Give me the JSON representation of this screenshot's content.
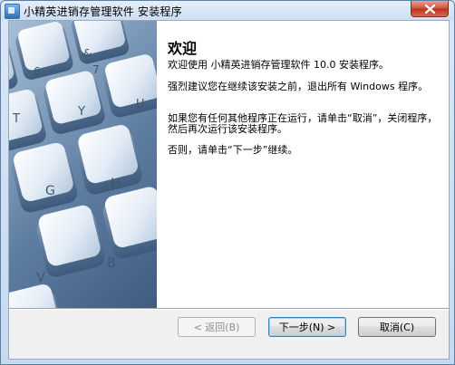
{
  "window": {
    "title": "小精英进销存管理软件 安装程序"
  },
  "colors": {
    "title_bar": "#dbe8f6",
    "close_button": "#c9523e",
    "content_bg": "#ffffff",
    "button_bg": "#e5e5e5",
    "focus_border": "#3c7fb1"
  },
  "icons": {
    "app": "installer-app-icon",
    "close": "close-icon",
    "side": "keyboard-keys-image"
  },
  "side_image": {
    "key_labels": [
      "6",
      "&",
      "7",
      "T",
      "Y",
      "U",
      "G",
      "H",
      "V",
      "B"
    ]
  },
  "content": {
    "heading": "欢迎",
    "paragraphs": [
      "欢迎使用 小精英进销存管理软件 10.0 安装程序。",
      "强烈建议您在继续该安装之前，退出所有 Windows 程序。",
      "如果您有任何其他程序正在运行，请单击“取消”，关闭程序，然后再次运行该安装程序。",
      "否则，请单击“下一步”继续。"
    ]
  },
  "buttons": {
    "back": "< 返回(B)",
    "next": "下一步(N) >",
    "cancel": "取消(C)"
  }
}
